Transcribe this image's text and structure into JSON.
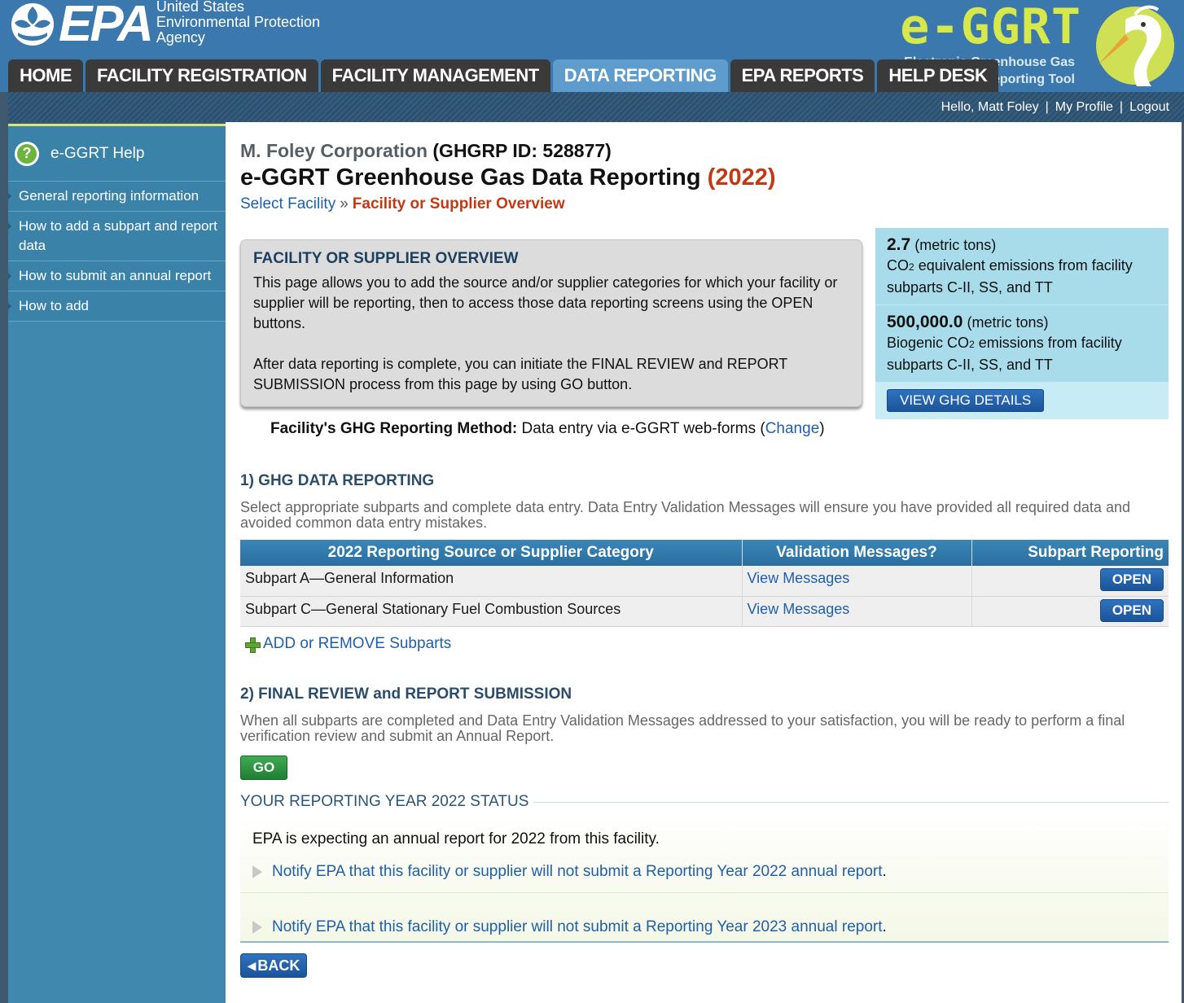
{
  "header": {
    "epa_word": "EPA",
    "agency_lines": [
      "United States",
      "Environmental Protection",
      "Agency"
    ],
    "app_logo_title": "e-GGRT",
    "app_logo_sub": [
      "Electronic Greenhouse Gas",
      "Reporting Tool"
    ]
  },
  "tabs": [
    {
      "label": "HOME",
      "active": false
    },
    {
      "label": "FACILITY REGISTRATION",
      "active": false
    },
    {
      "label": "FACILITY MANAGEMENT",
      "active": false
    },
    {
      "label": "DATA REPORTING",
      "active": true
    },
    {
      "label": "EPA REPORTS",
      "active": false
    },
    {
      "label": "HELP DESK",
      "active": false
    }
  ],
  "userbar": {
    "greeting": "Hello, Matt Foley",
    "profile": "My Profile",
    "logout": "Logout"
  },
  "sidebar": {
    "help_label": "e-GGRT Help",
    "items": [
      {
        "label": "General reporting information"
      },
      {
        "label": "How to add a subpart and report data"
      },
      {
        "label": "How to submit an annual report"
      },
      {
        "label": "How to add"
      }
    ]
  },
  "main": {
    "org_name": "M. Foley Corporation",
    "org_id": "(GHGRP ID: 528877)",
    "title": "e-GGRT Greenhouse Gas Data Reporting",
    "title_year": "(2022)",
    "breadcrumb": {
      "link": "Select Facility",
      "sep": "»",
      "current": "Facility or Supplier Overview"
    },
    "overview": {
      "title": "FACILITY OR SUPPLIER OVERVIEW",
      "p1": "This page allows you to add the source and/or supplier categories for which your facility or supplier will be reporting, then to access those data reporting screens using the OPEN buttons.",
      "p2": "After data reporting is complete, you can initiate the FINAL REVIEW and REPORT SUBMISSION process from this page by using GO button."
    },
    "emissions": {
      "co2e_value": "2.7",
      "co2e_unit": "(metric tons)",
      "co2e_prefix": "CO",
      "co2e_sub": "2",
      "co2e_desc": "equivalent emissions from facility subparts C-II, SS, and TT",
      "bio_value": "500,000.0",
      "bio_unit": "(metric tons)",
      "bio_prefix": "Biogenic CO",
      "bio_sub": "2",
      "bio_desc": "emissions from facility subparts C-II, SS, and TT",
      "details_button": "VIEW GHG DETAILS"
    },
    "method": {
      "label": "Facility's GHG Reporting Method:",
      "value": "Data entry via e-GGRT web-forms (",
      "link": "Change",
      "close": ")"
    },
    "section1": {
      "title": "1) GHG DATA REPORTING",
      "desc": "Select appropriate subparts and complete data entry. Data Entry Validation Messages will ensure you have provided all required data and avoided common data entry mistakes.",
      "columns": [
        "2022 Reporting Source or Supplier Category",
        "Validation Messages?",
        "Subpart Reporting"
      ],
      "rows": [
        {
          "category": "Subpart A—General Information",
          "messages": "View Messages",
          "action": "OPEN"
        },
        {
          "category": "Subpart C—General Stationary Fuel Combustion Sources",
          "messages": "View Messages",
          "action": "OPEN"
        }
      ],
      "add_remove": "ADD or REMOVE Subparts"
    },
    "section2": {
      "title": "2) FINAL REVIEW and REPORT SUBMISSION",
      "desc": "When all subparts are completed and Data Entry Validation Messages addressed to your satisfaction, you will be ready to perform a final verification review and submit an Annual Report.",
      "go": "GO"
    },
    "status": {
      "title": "YOUR REPORTING YEAR 2022 STATUS",
      "expecting": "EPA is expecting an annual report for 2022 from this facility.",
      "notify_2022": "Notify EPA that this facility or supplier will not submit a Reporting Year 2022 annual report",
      "notify_2023": "Notify EPA that this facility or supplier will not submit a Reporting Year 2023 annual report",
      "period": "."
    },
    "back": "BACK"
  },
  "colors": {
    "header_blue": "#3b78ad",
    "tab_dark": "#3a3a3a",
    "tab_active": "#5d9ccd",
    "sidebar_blue": "#4088ad",
    "accent_red": "#c23a14",
    "link_blue": "#1f5fa8",
    "go_green": "#2e9443"
  }
}
